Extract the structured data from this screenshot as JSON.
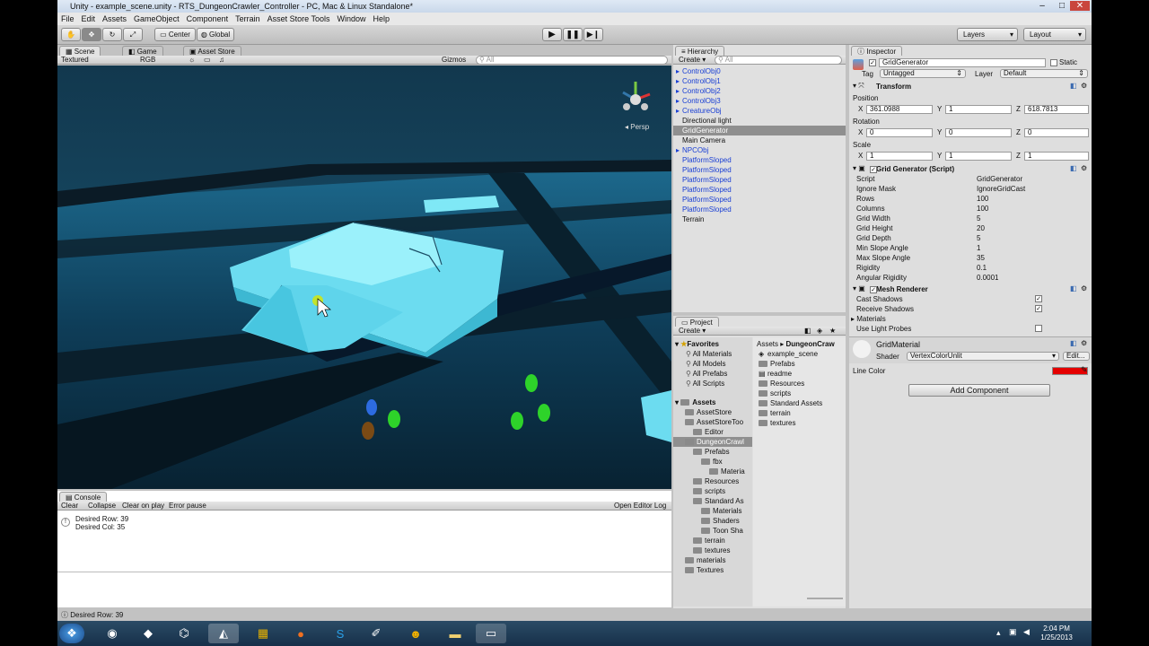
{
  "window": {
    "title": "Unity - example_scene.unity - RTS_DungeonCrawler_Controller - PC, Mac & Linux Standalone*"
  },
  "menu": [
    "File",
    "Edit",
    "Assets",
    "GameObject",
    "Component",
    "Terrain",
    "Asset Store Tools",
    "Window",
    "Help"
  ],
  "toolbar": {
    "center": "Center",
    "global": "Global",
    "layers": "Layers",
    "layout": "Layout"
  },
  "scene_tabs": {
    "scene": "Scene",
    "game": "Game",
    "asset_store": "Asset Store"
  },
  "scene_bar": {
    "render": "Textured",
    "color": "RGB",
    "gizmos": "Gizmos",
    "search": "All"
  },
  "scene_view": {
    "persp": "Persp"
  },
  "console": {
    "tab": "Console",
    "clear": "Clear",
    "collapse": "Collapse",
    "clear_on_play": "Clear on play",
    "error_pause": "Error pause",
    "open_editor_log": "Open Editor Log",
    "line1": "Desired Row: 39",
    "line2": "Desired Col: 35",
    "status": "Desired Row: 39"
  },
  "hierarchy": {
    "tab": "Hierarchy",
    "create": "Create",
    "search": "All",
    "items": [
      {
        "label": "ControlObj0",
        "blue": true,
        "arrow": true
      },
      {
        "label": "ControlObj1",
        "blue": true,
        "arrow": true
      },
      {
        "label": "ControlObj2",
        "blue": true,
        "arrow": true
      },
      {
        "label": "ControlObj3",
        "blue": true,
        "arrow": true
      },
      {
        "label": "CreatureObj",
        "blue": true,
        "arrow": true
      },
      {
        "label": "Directional light",
        "blue": false,
        "arrow": false
      },
      {
        "label": "GridGenerator",
        "blue": false,
        "arrow": false,
        "selected": true
      },
      {
        "label": "Main Camera",
        "blue": false,
        "arrow": false
      },
      {
        "label": "NPCObj",
        "blue": true,
        "arrow": true
      },
      {
        "label": "PlatformSloped",
        "blue": true,
        "arrow": false
      },
      {
        "label": "PlatformSloped",
        "blue": true,
        "arrow": false
      },
      {
        "label": "PlatformSloped",
        "blue": true,
        "arrow": false
      },
      {
        "label": "PlatformSloped",
        "blue": true,
        "arrow": false
      },
      {
        "label": "PlatformSloped",
        "blue": true,
        "arrow": false
      },
      {
        "label": "PlatformSloped",
        "blue": true,
        "arrow": false
      },
      {
        "label": "Terrain",
        "blue": false,
        "arrow": false
      }
    ]
  },
  "project": {
    "tab": "Project",
    "create": "Create",
    "favorites_label": "Favorites",
    "favorites": [
      "All Materials",
      "All Models",
      "All Prefabs",
      "All Scripts"
    ],
    "assets_label": "Assets",
    "tree": [
      {
        "label": "AssetStore",
        "indent": 1
      },
      {
        "label": "AssetStoreToo",
        "indent": 1
      },
      {
        "label": "Editor",
        "indent": 2
      },
      {
        "label": "DungeonCrawl",
        "indent": 1,
        "selected": true
      },
      {
        "label": "Prefabs",
        "indent": 2
      },
      {
        "label": "fbx",
        "indent": 3
      },
      {
        "label": "Materia",
        "indent": 4
      },
      {
        "label": "Resources",
        "indent": 2
      },
      {
        "label": "scripts",
        "indent": 2
      },
      {
        "label": "Standard As",
        "indent": 2
      },
      {
        "label": "Materials",
        "indent": 3
      },
      {
        "label": "Shaders",
        "indent": 3
      },
      {
        "label": "Toon Sha",
        "indent": 3
      },
      {
        "label": "terrain",
        "indent": 2
      },
      {
        "label": "textures",
        "indent": 2
      },
      {
        "label": "materials",
        "indent": 1
      },
      {
        "label": "Textures",
        "indent": 1
      }
    ],
    "breadcrumb_root": "Assets",
    "breadcrumb_leaf": "DungeonCraw",
    "files": [
      "example_scene",
      "Prefabs",
      "readme",
      "Resources",
      "scripts",
      "Standard Assets",
      "terrain",
      "textures"
    ]
  },
  "inspector": {
    "tab": "Inspector",
    "object_name": "GridGenerator",
    "static": "Static",
    "tag_label": "Tag",
    "tag": "Untagged",
    "layer_label": "Layer",
    "layer": "Default",
    "transform": {
      "title": "Transform",
      "position_label": "Position",
      "rotation_label": "Rotation",
      "scale_label": "Scale",
      "axis_x": "X",
      "axis_y": "Y",
      "axis_z": "Z",
      "position": [
        "361.0988",
        "1",
        "618.7813"
      ],
      "rotation": [
        "0",
        "0",
        "0"
      ],
      "scale": [
        "1",
        "1",
        "1"
      ]
    },
    "grid_generator": {
      "title": "Grid Generator (Script)",
      "props": [
        {
          "label": "Script",
          "value": "GridGenerator"
        },
        {
          "label": "Ignore Mask",
          "value": "IgnoreGridCast"
        },
        {
          "label": "Rows",
          "value": "100"
        },
        {
          "label": "Columns",
          "value": "100"
        },
        {
          "label": "Grid Width",
          "value": "5"
        },
        {
          "label": "Grid Height",
          "value": "20"
        },
        {
          "label": "Grid Depth",
          "value": "5"
        },
        {
          "label": "Min Slope Angle",
          "value": "1"
        },
        {
          "label": "Max Slope Angle",
          "value": "35"
        },
        {
          "label": "Rigidity",
          "value": "0.1"
        },
        {
          "label": "Angular Rigidity",
          "value": "0.0001"
        }
      ]
    },
    "mesh_renderer": {
      "title": "Mesh Renderer",
      "cast_shadows": "Cast Shadows",
      "receive_shadows": "Receive Shadows",
      "materials": "Materials",
      "use_light_probes": "Use Light Probes"
    },
    "material": {
      "name": "GridMaterial",
      "shader_label": "Shader",
      "shader": "VertexColorUnlit",
      "edit": "Edit...",
      "line_color_label": "Line Color",
      "line_color": "#e40000"
    },
    "add_component": "Add Component"
  },
  "system_tray": {
    "time": "2:04 PM",
    "date": "1/25/2013"
  }
}
